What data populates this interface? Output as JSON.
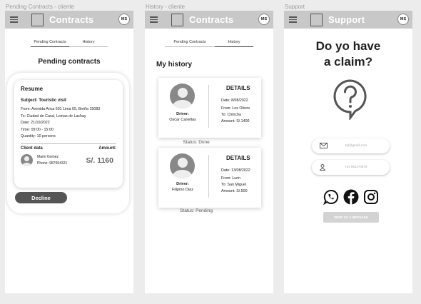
{
  "frames": {
    "pending": {
      "label": "Pending Contracts - cliente",
      "topbar_title": "Contracts",
      "avatar_initials": "MS",
      "tabs": [
        "Pending Contracts",
        "History"
      ],
      "heading": "Pending contracts",
      "resume": {
        "title": "Resume",
        "subject": "Subject: Touristic visit",
        "from": "From: Avenida Arica 601 Lima 05, Breña 15083",
        "to": "To:    Ciudad de Caral, Lomas de Lachay",
        "date": "Date: 21/10/2022",
        "time": "Time: 09:00 - 15:00",
        "quantity": "Quantity: 10 persons",
        "client_label": "Client data",
        "amount_label": "Amount:",
        "client_name": "Mario Gomez",
        "client_phone": "Phone: 987654321",
        "amount": "S/. 1160"
      },
      "decline_label": "Decline"
    },
    "history": {
      "label": "History - cliente",
      "topbar_title": "Contracts",
      "avatar_initials": "MS",
      "tabs": [
        "Pending Contracts",
        "History"
      ],
      "heading": "My history",
      "cards": [
        {
          "driver_label": "Driver:",
          "driver_name": "Oscar Canellas",
          "details_label": "DETAILS",
          "date": "Date: 8/08/2022",
          "from": "From: Los Olivos",
          "to": "To:    Chincha",
          "amount": "Amount: S/.1400",
          "status": "Status: Done"
        },
        {
          "driver_label": "Driver:",
          "driver_name": "Filipino Diaz",
          "details_label": "DETAILS",
          "date": "Date: 13/08/2022",
          "from": "From: Lurin",
          "to": "To:    San Miguel",
          "amount": "Amount: S/.500",
          "status": "Status: Pending"
        }
      ]
    },
    "support": {
      "label": "Support",
      "topbar_title": "Support",
      "avatar_initials": "MS",
      "heading_line1": "Do yo have",
      "heading_line2": "a claim?",
      "email_placeholder": "1pl@gmail.com",
      "phone_placeholder": "+51 963270579",
      "socials": [
        "whatsapp-icon",
        "facebook-icon",
        "instagram-icon"
      ],
      "send_label": "SEND US A MESSAGE"
    }
  }
}
